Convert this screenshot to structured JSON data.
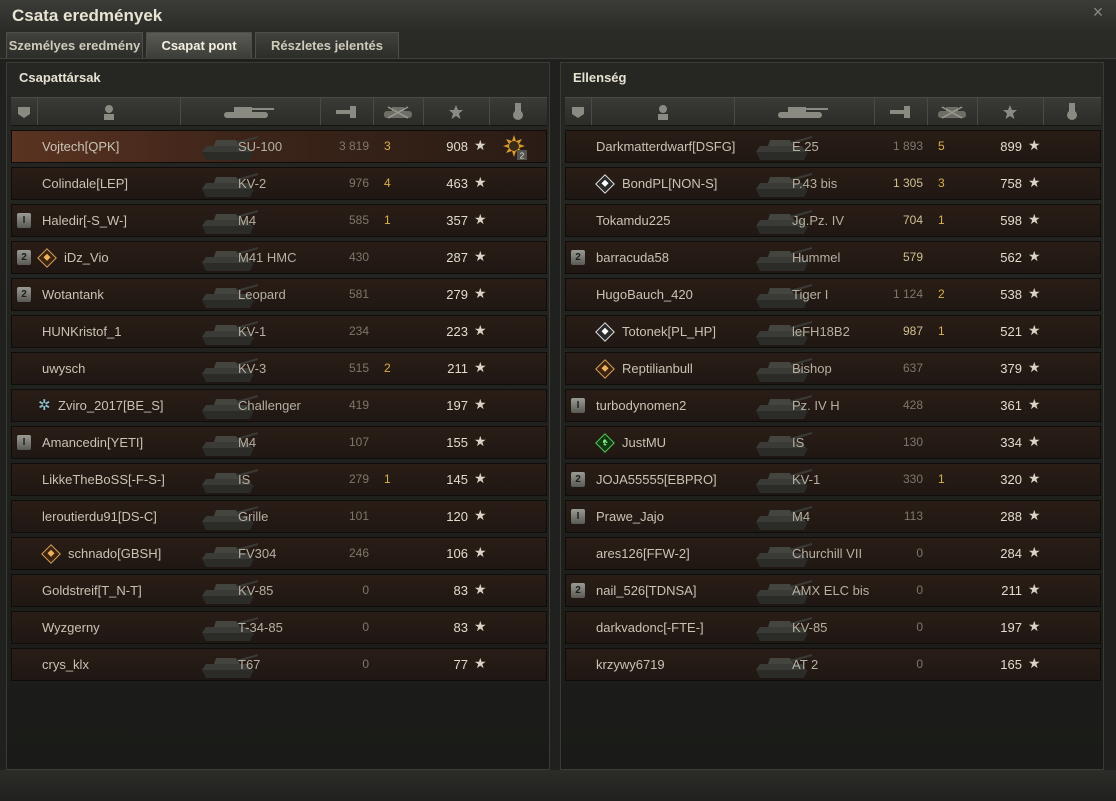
{
  "window": {
    "title": "Csata eredmények",
    "close_glyph": "×"
  },
  "tabs": [
    {
      "label": "Személyes eredmény",
      "active": false
    },
    {
      "label": "Csapat pont",
      "active": true
    },
    {
      "label": "Részletes jelentés",
      "active": false
    }
  ],
  "left_panel": {
    "title": "Csapattársak",
    "rows": [
      {
        "player": "Vojtech[QPK]",
        "tank": "SU-100",
        "damage": "3 819",
        "kills": "3",
        "xp": "908",
        "me": true,
        "medal": "2"
      },
      {
        "player": "Colindale[LEP]",
        "tank": "KV-2",
        "damage": "976",
        "kills": "4",
        "xp": "463"
      },
      {
        "player": "Haledir[-S_W-]",
        "tank": "M4",
        "damage": "585",
        "kills": "1",
        "xp": "357",
        "badge": "I"
      },
      {
        "player": "iDz_Vio",
        "tank": "M41 HMC",
        "damage": "430",
        "kills": "",
        "xp": "287",
        "badge": "2",
        "eff": "orange"
      },
      {
        "player": "Wotantank",
        "tank": "Leopard",
        "damage": "581",
        "kills": "",
        "xp": "279",
        "badge": "2"
      },
      {
        "player": "HUNKristof_1",
        "tank": "KV-1",
        "damage": "234",
        "kills": "",
        "xp": "223"
      },
      {
        "player": "uwysch",
        "tank": "KV-3",
        "damage": "515",
        "kills": "2",
        "xp": "211"
      },
      {
        "player": "Zviro_2017[BE_S]",
        "tank": "Challenger",
        "damage": "419",
        "kills": "",
        "xp": "197",
        "eff": "star"
      },
      {
        "player": "Amancedin[YETI]",
        "tank": "M4",
        "damage": "107",
        "kills": "",
        "xp": "155",
        "badge": "I"
      },
      {
        "player": "LikkeTheBoSS[-F-S-]",
        "tank": "IS",
        "damage": "279",
        "kills": "1",
        "xp": "145"
      },
      {
        "player": "leroutierdu91[DS-C]",
        "tank": "Grille",
        "damage": "101",
        "kills": "",
        "xp": "120"
      },
      {
        "player": "schnado[GBSH]",
        "tank": "FV304",
        "damage": "246",
        "kills": "",
        "xp": "106",
        "eff": "orange"
      },
      {
        "player": "Goldstreif[T_N-T]",
        "tank": "KV-85",
        "damage": "0",
        "kills": "",
        "xp": "83"
      },
      {
        "player": "Wyzgerny",
        "tank": "T-34-85",
        "damage": "0",
        "kills": "",
        "xp": "83"
      },
      {
        "player": "crys_klx",
        "tank": "T67",
        "damage": "0",
        "kills": "",
        "xp": "77"
      }
    ]
  },
  "right_panel": {
    "title": "Ellenség",
    "rows": [
      {
        "player": "Darkmatterdwarf[DSFG]",
        "tank": "E 25",
        "damage": "1 893",
        "kills": "5",
        "xp": "899"
      },
      {
        "player": "BondPL[NON-S]",
        "tank": "P.43 bis",
        "damage": "1 305",
        "kills": "3",
        "xp": "758",
        "eff": "white",
        "hi": true
      },
      {
        "player": "Tokamdu225",
        "tank": "Jg.Pz. IV",
        "damage": "704",
        "kills": "1",
        "xp": "598",
        "hi": true
      },
      {
        "player": "barracuda58",
        "tank": "Hummel",
        "damage": "579",
        "kills": "",
        "xp": "562",
        "badge": "2",
        "hi": true
      },
      {
        "player": "HugoBauch_420",
        "tank": "Tiger I",
        "damage": "1 124",
        "kills": "2",
        "xp": "538"
      },
      {
        "player": "Totonek[PL_HP]",
        "tank": "leFH18B2",
        "damage": "987",
        "kills": "1",
        "xp": "521",
        "eff": "white",
        "hi": true
      },
      {
        "player": "Reptilianbull",
        "tank": "Bishop",
        "damage": "637",
        "kills": "",
        "xp": "379",
        "eff": "orange"
      },
      {
        "player": "turbodynomen2",
        "tank": "Pz. IV H",
        "damage": "428",
        "kills": "",
        "xp": "361",
        "badge": "I"
      },
      {
        "player": "JustMU",
        "tank": "IS",
        "damage": "130",
        "kills": "",
        "xp": "334",
        "eff": "green",
        "eff_num": "13"
      },
      {
        "player": "JOJA55555[EBPRO]",
        "tank": "KV-1",
        "damage": "330",
        "kills": "1",
        "xp": "320",
        "badge": "2"
      },
      {
        "player": "Prawe_Jajo",
        "tank": "M4",
        "damage": "113",
        "kills": "",
        "xp": "288",
        "badge": "I"
      },
      {
        "player": "ares126[FFW-2]",
        "tank": "Churchill VII",
        "damage": "0",
        "kills": "",
        "xp": "284"
      },
      {
        "player": "nail_526[TDNSA]",
        "tank": "AMX ELC bis",
        "damage": "0",
        "kills": "",
        "xp": "211",
        "badge": "2"
      },
      {
        "player": "darkvadonc[-FTE-]",
        "tank": "KV-85",
        "damage": "0",
        "kills": "",
        "xp": "197"
      },
      {
        "player": "krzywy6719",
        "tank": "AT 2",
        "damage": "0",
        "kills": "",
        "xp": "165"
      }
    ]
  },
  "icons": {
    "squad": "squad-icon",
    "player": "player-icon",
    "tank": "tank-icon",
    "damage": "damage-icon",
    "kills": "kills-icon",
    "xp": "xp-star-icon",
    "medal": "medal-icon",
    "star": "★"
  }
}
